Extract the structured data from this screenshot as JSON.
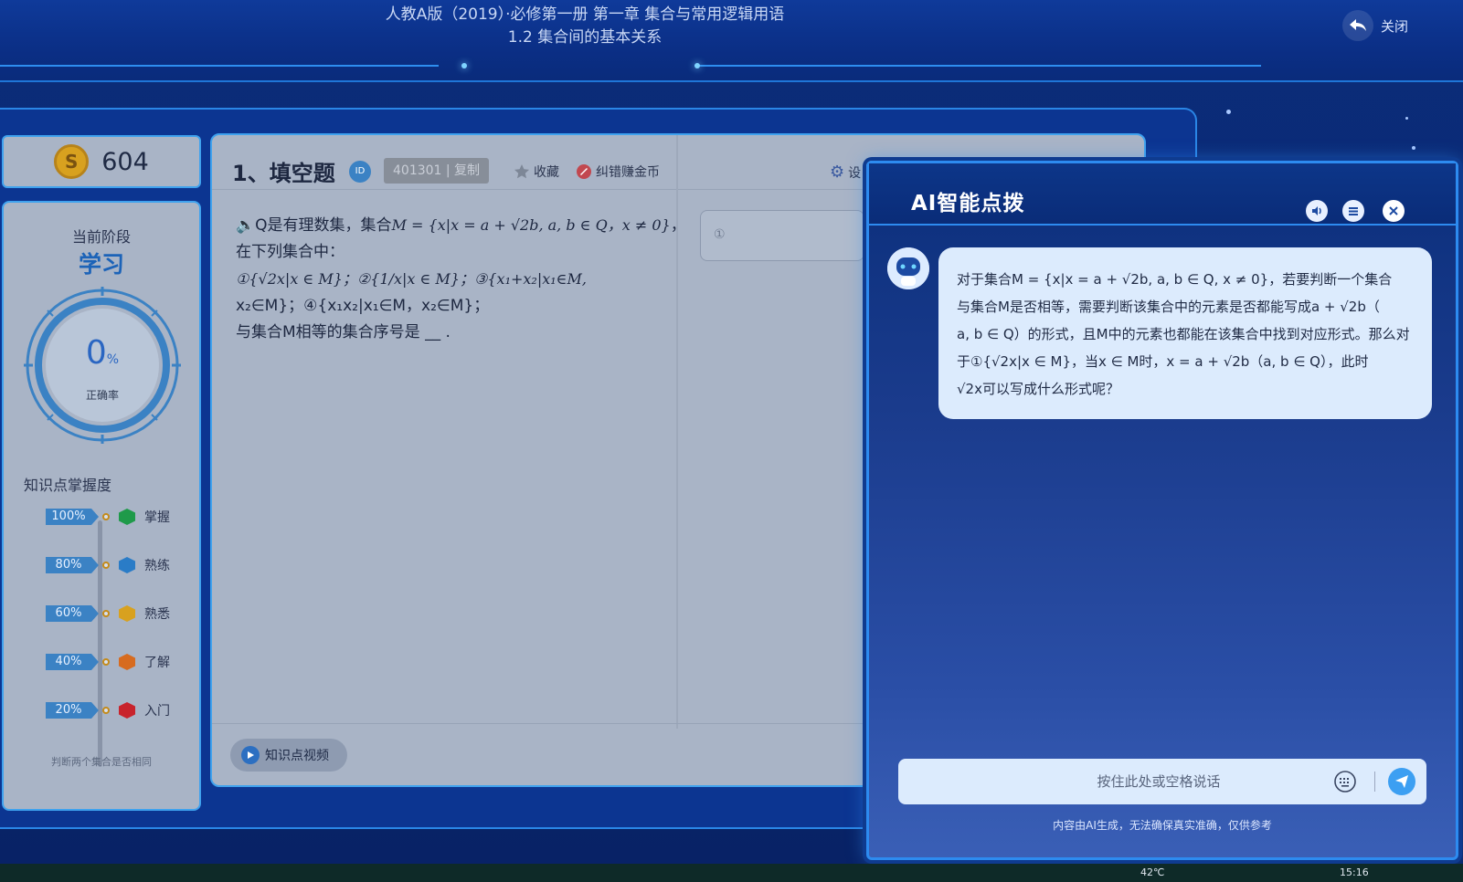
{
  "header": {
    "title_line1": "人教A版（2019）·必修第一册   第一章 集合与常用逻辑用语",
    "title_line2": "1.2 集合间的基本关系",
    "close_label": "关闭"
  },
  "coins": {
    "symbol": "S",
    "count": "604"
  },
  "side": {
    "stage_label": "当前阶段",
    "stage_value": "学习",
    "accuracy_value": "0",
    "accuracy_unit": "%",
    "accuracy_label": "正确率",
    "accuracy_fraction": 0,
    "mastery_title": "知识点掌握度",
    "mastery_levels": [
      {
        "pct": "100%",
        "label": "掌握",
        "color": "#1f9a4a"
      },
      {
        "pct": "80%",
        "label": "熟练",
        "color": "#2a7cc7"
      },
      {
        "pct": "60%",
        "label": "熟悉",
        "color": "#d8a11f"
      },
      {
        "pct": "40%",
        "label": "了解",
        "color": "#d76b1f"
      },
      {
        "pct": "20%",
        "label": "入门",
        "color": "#c8232c"
      }
    ],
    "footer": "判断两个集合是否相同"
  },
  "question": {
    "title": "1、填空题",
    "id_badge": "ID",
    "id_code": "401301 | 复制",
    "favorite": "收藏",
    "report": "纠错赚金币",
    "settings": "设",
    "line1_a": "Q是有理数集，集合",
    "line1_math": "M = {x|x = a + √2b, a, b ∈ Q，x ≠ 0}",
    "line1_b": "，",
    "line2": "在下列集合中：",
    "line3_math": "①{√2x|x ∈ M}；②{1/x|x ∈ M}；③{x₁+x₂|x₁∈M,",
    "line4": "x₂∈M}；④{x₁x₂|x₁∈M，x₂∈M}；",
    "line5": "与集合M相等的集合序号是 __ .",
    "answer_placeholder": "①",
    "video_button": "知识点视频"
  },
  "ai": {
    "title": "AI智能点拨",
    "message": [
      "对于集合M = {x|x = a + √2b, a, b ∈ Q, x ≠ 0}，若要判断一个集合",
      "与集合M是否相等，需要判断该集合中的元素是否都能写成a + √2b（",
      "a, b ∈ Q）的形式，且M中的元素也都能在该集合中找到对应形式。那么对",
      "于①{√2x|x ∈ M}，当x ∈ M时，x = a + √2b（a, b ∈ Q），此时",
      "√2x可以写成什么形式呢？"
    ],
    "input_placeholder": "按住此处或空格说话",
    "disclaimer": "内容由AI生成，无法确保真实准确，仅供参考"
  },
  "taskbar": {
    "temp": "42℃",
    "time": "15:16"
  },
  "colors": {
    "accent": "#2d8bf0",
    "brand_blue": "#0b2f7c",
    "bubble": "#dcebfd"
  }
}
